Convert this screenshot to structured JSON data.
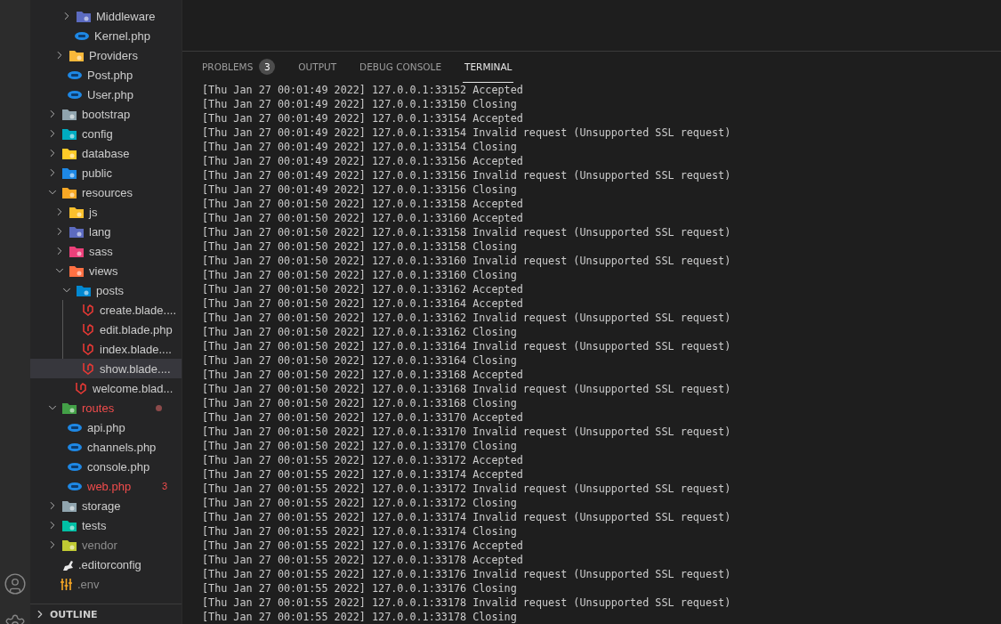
{
  "explorer": {
    "tree": [
      {
        "children": [
          {
            "children": [
              {
                "name": "Middleware",
                "kind": "folder",
                "color": "#5c6bc0",
                "expanded": false,
                "selected": false,
                "error": false,
                "ignored": false
              },
              {
                "name": "Kernel.php",
                "kind": "php",
                "selected": false,
                "error": false,
                "ignored": false
              }
            ]
          },
          {
            "name": "Providers",
            "kind": "folder",
            "color": "#f9b83a",
            "expanded": false,
            "selected": false,
            "error": false,
            "ignored": false
          },
          {
            "name": "Post.php",
            "kind": "php",
            "selected": false,
            "error": false,
            "ignored": false
          },
          {
            "name": "User.php",
            "kind": "php",
            "selected": false,
            "error": false,
            "ignored": false
          }
        ]
      },
      {
        "name": "bootstrap",
        "kind": "folder",
        "color": "#90a4ae",
        "expanded": false,
        "selected": false,
        "error": false,
        "ignored": false
      },
      {
        "name": "config",
        "kind": "folder",
        "color": "#00acc1",
        "expanded": false,
        "selected": false,
        "error": false,
        "ignored": false
      },
      {
        "name": "database",
        "kind": "folder",
        "color": "#ffca28",
        "expanded": false,
        "selected": false,
        "error": false,
        "ignored": false
      },
      {
        "name": "public",
        "kind": "folder",
        "color": "#1e88e5",
        "expanded": false,
        "selected": false,
        "error": false,
        "ignored": false
      },
      {
        "name": "resources",
        "kind": "folder",
        "color": "#f9a825",
        "expanded": true,
        "selected": false,
        "error": false,
        "ignored": false,
        "children": [
          {
            "name": "js",
            "kind": "folder",
            "color": "#fbc02d",
            "expanded": false,
            "selected": false,
            "error": false,
            "ignored": false
          },
          {
            "name": "lang",
            "kind": "folder",
            "color": "#5c6bc0",
            "expanded": false,
            "selected": false,
            "error": false,
            "ignored": false
          },
          {
            "name": "sass",
            "kind": "folder",
            "color": "#ec407a",
            "expanded": false,
            "selected": false,
            "error": false,
            "ignored": false
          },
          {
            "name": "views",
            "kind": "folder",
            "color": "#ff7043",
            "expanded": true,
            "selected": false,
            "error": false,
            "ignored": false,
            "children": [
              {
                "name": "posts",
                "kind": "folder",
                "color": "#0288d1",
                "expanded": true,
                "selected": false,
                "error": false,
                "ignored": false,
                "children": [
                  {
                    "name": "create.blade....",
                    "kind": "blade",
                    "selected": false,
                    "error": false,
                    "ignored": false
                  },
                  {
                    "name": "edit.blade.php",
                    "kind": "blade",
                    "selected": false,
                    "error": false,
                    "ignored": false
                  },
                  {
                    "name": "index.blade....",
                    "kind": "blade",
                    "selected": false,
                    "error": false,
                    "ignored": false
                  },
                  {
                    "name": "show.blade....",
                    "kind": "blade",
                    "selected": true,
                    "error": false,
                    "ignored": false
                  }
                ]
              },
              {
                "name": "welcome.blad...",
                "kind": "blade",
                "selected": false,
                "error": false,
                "ignored": false
              }
            ]
          }
        ]
      },
      {
        "name": "routes",
        "kind": "folder",
        "color": "#43a047",
        "expanded": true,
        "selected": false,
        "error": true,
        "ignored": false,
        "problem_dot": true,
        "children": [
          {
            "name": "api.php",
            "kind": "php",
            "selected": false,
            "error": false,
            "ignored": false
          },
          {
            "name": "channels.php",
            "kind": "php",
            "selected": false,
            "error": false,
            "ignored": false
          },
          {
            "name": "console.php",
            "kind": "php",
            "selected": false,
            "error": false,
            "ignored": false
          },
          {
            "name": "web.php",
            "kind": "php",
            "selected": false,
            "error": true,
            "ignored": false,
            "badge": "3"
          }
        ]
      },
      {
        "name": "storage",
        "kind": "folder",
        "color": "#90a4ae",
        "expanded": false,
        "selected": false,
        "error": false,
        "ignored": false
      },
      {
        "name": "tests",
        "kind": "folder",
        "color": "#00bfa5",
        "expanded": false,
        "selected": false,
        "error": false,
        "ignored": false
      },
      {
        "name": "vendor",
        "kind": "folder",
        "color": "#c0ca33",
        "expanded": false,
        "selected": false,
        "error": false,
        "ignored": true
      },
      {
        "name": ".editorconfig",
        "kind": "editorconfig",
        "selected": false,
        "error": false,
        "ignored": false
      },
      {
        "name": ".env",
        "kind": "env",
        "selected": false,
        "error": false,
        "ignored": true
      }
    ],
    "outline": {
      "title": "OUTLINE",
      "expanded": false
    }
  },
  "panel": {
    "tabs": [
      {
        "label": "PROBLEMS",
        "badge": "3",
        "selected": false
      },
      {
        "label": "OUTPUT",
        "selected": false
      },
      {
        "label": "DEBUG CONSOLE",
        "selected": false
      },
      {
        "label": "TERMINAL",
        "selected": true
      }
    ],
    "terminal_lines": [
      "[Thu Jan 27 00:01:49 2022] 127.0.0.1:33152 Accepted",
      "[Thu Jan 27 00:01:49 2022] 127.0.0.1:33150 Closing",
      "[Thu Jan 27 00:01:49 2022] 127.0.0.1:33154 Accepted",
      "[Thu Jan 27 00:01:49 2022] 127.0.0.1:33154 Invalid request (Unsupported SSL request)",
      "[Thu Jan 27 00:01:49 2022] 127.0.0.1:33154 Closing",
      "[Thu Jan 27 00:01:49 2022] 127.0.0.1:33156 Accepted",
      "[Thu Jan 27 00:01:49 2022] 127.0.0.1:33156 Invalid request (Unsupported SSL request)",
      "[Thu Jan 27 00:01:49 2022] 127.0.0.1:33156 Closing",
      "[Thu Jan 27 00:01:50 2022] 127.0.0.1:33158 Accepted",
      "[Thu Jan 27 00:01:50 2022] 127.0.0.1:33160 Accepted",
      "[Thu Jan 27 00:01:50 2022] 127.0.0.1:33158 Invalid request (Unsupported SSL request)",
      "[Thu Jan 27 00:01:50 2022] 127.0.0.1:33158 Closing",
      "[Thu Jan 27 00:01:50 2022] 127.0.0.1:33160 Invalid request (Unsupported SSL request)",
      "[Thu Jan 27 00:01:50 2022] 127.0.0.1:33160 Closing",
      "[Thu Jan 27 00:01:50 2022] 127.0.0.1:33162 Accepted",
      "[Thu Jan 27 00:01:50 2022] 127.0.0.1:33164 Accepted",
      "[Thu Jan 27 00:01:50 2022] 127.0.0.1:33162 Invalid request (Unsupported SSL request)",
      "[Thu Jan 27 00:01:50 2022] 127.0.0.1:33162 Closing",
      "[Thu Jan 27 00:01:50 2022] 127.0.0.1:33164 Invalid request (Unsupported SSL request)",
      "[Thu Jan 27 00:01:50 2022] 127.0.0.1:33164 Closing",
      "[Thu Jan 27 00:01:50 2022] 127.0.0.1:33168 Accepted",
      "[Thu Jan 27 00:01:50 2022] 127.0.0.1:33168 Invalid request (Unsupported SSL request)",
      "[Thu Jan 27 00:01:50 2022] 127.0.0.1:33168 Closing",
      "[Thu Jan 27 00:01:50 2022] 127.0.0.1:33170 Accepted",
      "[Thu Jan 27 00:01:50 2022] 127.0.0.1:33170 Invalid request (Unsupported SSL request)",
      "[Thu Jan 27 00:01:50 2022] 127.0.0.1:33170 Closing",
      "[Thu Jan 27 00:01:55 2022] 127.0.0.1:33172 Accepted",
      "[Thu Jan 27 00:01:55 2022] 127.0.0.1:33174 Accepted",
      "[Thu Jan 27 00:01:55 2022] 127.0.0.1:33172 Invalid request (Unsupported SSL request)",
      "[Thu Jan 27 00:01:55 2022] 127.0.0.1:33172 Closing",
      "[Thu Jan 27 00:01:55 2022] 127.0.0.1:33174 Invalid request (Unsupported SSL request)",
      "[Thu Jan 27 00:01:55 2022] 127.0.0.1:33174 Closing",
      "[Thu Jan 27 00:01:55 2022] 127.0.0.1:33176 Accepted",
      "[Thu Jan 27 00:01:55 2022] 127.0.0.1:33178 Accepted",
      "[Thu Jan 27 00:01:55 2022] 127.0.0.1:33176 Invalid request (Unsupported SSL request)",
      "[Thu Jan 27 00:01:55 2022] 127.0.0.1:33176 Closing",
      "[Thu Jan 27 00:01:55 2022] 127.0.0.1:33178 Invalid request (Unsupported SSL request)",
      "[Thu Jan 27 00:01:55 2022] 127.0.0.1:33178 Closing"
    ]
  }
}
